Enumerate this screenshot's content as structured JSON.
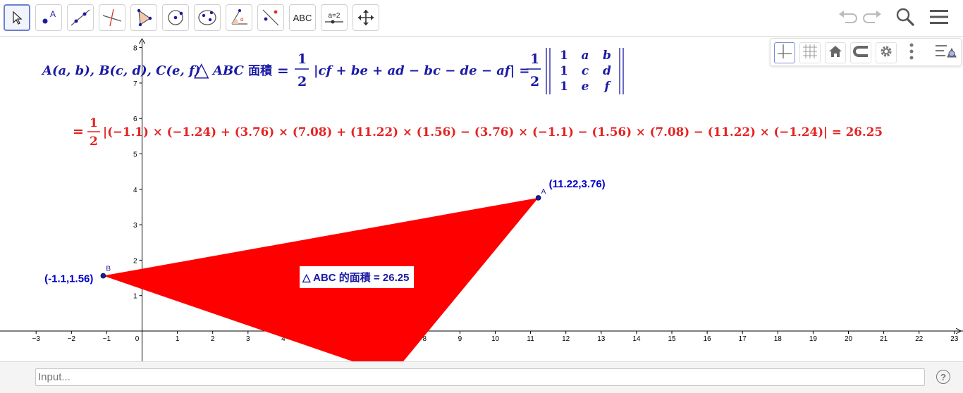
{
  "toolbar": {
    "tools": [
      {
        "name": "move-tool",
        "icon": "cursor-arrow-icon",
        "active": true
      },
      {
        "name": "point-tool",
        "icon": "point-A-icon"
      },
      {
        "name": "line-tool",
        "icon": "line-through-points-icon"
      },
      {
        "name": "perpendicular-line-tool",
        "icon": "perpendicular-line-icon"
      },
      {
        "name": "polygon-tool",
        "icon": "polygon-icon"
      },
      {
        "name": "circle-tool",
        "icon": "circle-center-point-icon"
      },
      {
        "name": "ellipse-tool",
        "icon": "ellipse-icon"
      },
      {
        "name": "angle-tool",
        "icon": "angle-icon"
      },
      {
        "name": "reflect-tool",
        "icon": "reflect-about-line-icon"
      },
      {
        "name": "text-tool",
        "icon": "text-icon",
        "label": "ABC"
      },
      {
        "name": "slider-tool",
        "icon": "slider-icon",
        "label": "a=2"
      },
      {
        "name": "move-graphics-tool",
        "icon": "move-view-icon"
      }
    ],
    "right": [
      "undo-icon",
      "redo-icon",
      "search-icon",
      "menu-icon"
    ]
  },
  "stylebar": [
    "axes-icon",
    "grid-icon",
    "home-icon",
    "point-capturing-icon",
    "settings-icon",
    "more-icon",
    "toggle-style-bar-icon"
  ],
  "formula": {
    "line1": {
      "points": "A(a, b), B(c, d), C(e, f)",
      "tri": "△",
      "abc": "ABC",
      "area_word": "面積",
      "eq": "=",
      "half_num": "1",
      "half_den": "2",
      "expr": "|cf + be + ad − bc − de − af| =",
      "half2_num": "1",
      "half2_den": "2",
      "matrix": [
        [
          "1",
          "a",
          "b"
        ],
        [
          "1",
          "c",
          "d"
        ],
        [
          "1",
          "e",
          "f"
        ]
      ]
    },
    "line2": {
      "eq": "=",
      "half_num": "1",
      "half_den": "2",
      "expr": "|(−1.1) × (−1.24) + (3.76) × (7.08) + (11.22) × (1.56) − (3.76) × (−1.1) − (1.56) × (7.08) − (11.22) × (−1.24)| = 26.25"
    }
  },
  "graph": {
    "x_ticks": [
      "−3",
      "−2",
      "−1",
      "0",
      "1",
      "2",
      "3",
      "4",
      "5",
      "6",
      "7",
      "8",
      "9",
      "10",
      "11",
      "12",
      "13",
      "14",
      "15",
      "16",
      "17",
      "18",
      "19",
      "20",
      "21",
      "22",
      "23"
    ],
    "y_ticks": [
      "1",
      "2",
      "3",
      "4",
      "5",
      "6",
      "7",
      "8"
    ],
    "points": {
      "A": {
        "name": "A",
        "label": "(11.22,3.76)",
        "x": 11.22,
        "y": 3.76
      },
      "B": {
        "name": "B",
        "label": "(-1.1,1.56)",
        "x": -1.1,
        "y": 1.56
      },
      "C": {
        "x": 7.08,
        "y": -1.24
      }
    },
    "triangle_color": "#ff0000",
    "point_color": "#1a1aa6",
    "area_label": "△ ABC 的面積 = 26.25"
  },
  "input": {
    "placeholder": "Input...",
    "help": "?"
  }
}
